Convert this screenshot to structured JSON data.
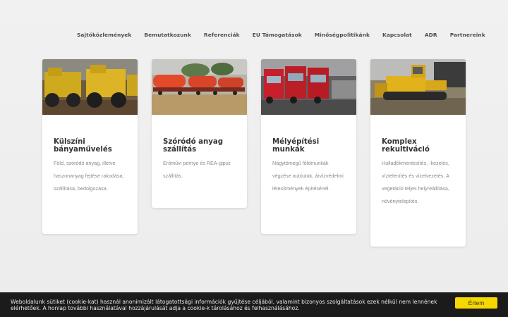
{
  "nav": {
    "items": [
      {
        "label": "Sajtóközlemények"
      },
      {
        "label": "Bemutatkozunk"
      },
      {
        "label": "Referenciák"
      },
      {
        "label": "EU Támogatások"
      },
      {
        "label": "Minőségpolitikánk"
      },
      {
        "label": "Kapcsolat"
      },
      {
        "label": "ADR"
      },
      {
        "label": "Partnereink"
      }
    ]
  },
  "cards": [
    {
      "title": "Külszíni bányaművelés",
      "description": "Föld, szóródó anyag, illetve haszonanyag fejtése rakodása, szállítása, bedolgozása."
    },
    {
      "title": "Szóródó anyag szállítás",
      "description": "Erőművi pernye és REA-gipsz szállítás."
    },
    {
      "title": "Mélyépítési munkák",
      "description": "Nagytömegű földmunkák végzése autóutak, árvízvédelmi létesítmények építésénél."
    },
    {
      "title": "Komplex rekultiváció",
      "description": "Hulladékmentesítés, -kezelés, víztelenítés és vízelvezetés. A vegetáció teljes helyreállítása, növénytelepítés."
    }
  ],
  "cookie": {
    "text": "Weboldalunk sütiket (cookie-kat) használ anonimizált látogatottsági információk gyűjtése céljából, valamint bizonyos szolgáltatások ezek nélkül nem lennének elérhetőek. A honlap további használatával hozzájárulását adja a cookie-k tárolásához és felhasználásához.",
    "button_label": "Értem"
  },
  "colors": {
    "accent": "#f5d800",
    "cookie_bar": "#1b1b1b",
    "background": "#efefef"
  }
}
